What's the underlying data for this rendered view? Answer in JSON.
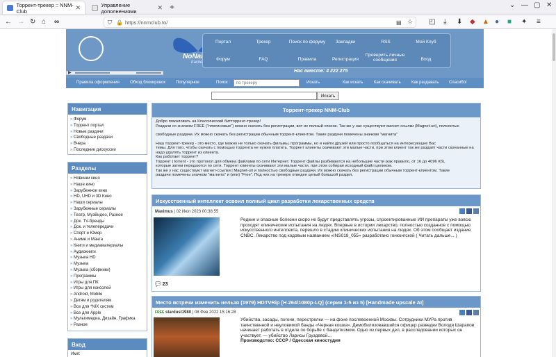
{
  "browser": {
    "tabs": [
      {
        "title": "Торрент-трекер :: NNM-Club",
        "active": true
      },
      {
        "title": "Управление дополнениями",
        "active": false
      }
    ],
    "url": "https://nnmclub.to/"
  },
  "site": {
    "logo_text": "NoNaMe Club",
    "logo_sub": "tracker & forum",
    "top_menu": [
      [
        "Портал",
        "Трекер",
        "Поиск по форуму",
        "Закладки",
        "RSS",
        "Мой Клуб"
      ],
      [
        "Форум",
        "FAQ",
        "Правила",
        "Регистрация",
        "Проверить личные сообщения",
        "Вход"
      ]
    ],
    "online": "Нас вместе: 4 222 275",
    "subnav": {
      "left": [
        "Правила оформления",
        "Обход блокировок",
        "Популярное"
      ],
      "search_label": "Поиск :",
      "search_placeholder": "по трекеру",
      "search_btn": "Искать",
      "right": [
        "Как искать",
        "Как скачивать",
        "Как раздавать",
        "Спасибо!"
      ]
    },
    "global_search_btn": "Искать"
  },
  "sidebar": {
    "nav_title": "Навигация",
    "nav_items": [
      "Форум",
      "Торрент портал",
      "Новые раздачи",
      "Свободные раздачи",
      "Вчера",
      "Последние дискуссии"
    ],
    "sections_title": "Разделы",
    "sections": [
      "Новинки кино",
      "Наше кино",
      "Зарубежное кино",
      "HD, UHD и 3D Кино",
      "Наши сериалы",
      "Зарубежные сериалы",
      "Театр, МузВидео, Разное",
      "Док. TV-бренды",
      "Док. и телепередачи",
      "Спорт и Юмор",
      "Аниме и Манга",
      "Книги и медиаматериалы",
      "Аудиокниги",
      "Музыка HD",
      "Музыка",
      "Музыка (сборники)",
      "Программы",
      "Игры для ПК",
      "Игры для консолей",
      "Android, Mobile",
      "Детям и родителям",
      "Все для *NIX систем",
      "Все для Apple",
      "Мультимедиа, Дизайн, Графика",
      "Разное"
    ],
    "login_title": "Вход",
    "login_label": "Имя:"
  },
  "welcome": {
    "title": "Торрент-трекер NNM-Club",
    "lines": [
      "Добро пожаловать на Классический битторрент-трекер!",
      "Раздачи со значком FREE (\"платиновые\") можно скачать без регистрации, вот их полный список. Так же у нас существуют магнет-ссылки (Magnet-uri), полностью",
      "свободные раздачи. Их можно скачать без регистрации обычным торрент-клиентом. Такие раздачи помечены значком \"магнита\"",
      "Наш торрент-трекер - это место, где можно не только скачать фильмы, программы, но и найти друзей или просто пообщаться на интересующие Вас",
      "темы. Для того, чтобы скачать с помощью торрента не нужно платить. Торрент клиенты скачивают эти малые части, при этом клиент так же раздаёт части скачанные на",
      "надо удалять торрент из клиента.",
      "Как работает торрент?",
      "Торрент | torrent - это протокол для обмена файлами по сети Интернет. Торрент файлы разбиваются на небольшие части (как правило, от 16 до 4096 Кб),",
      "которые затем передаются по сети. Торрент клиенты скачивают эти малые части, при этом собирая исходный файл целиком.",
      "Так же у нас существуют магнет-ссылки | Magnet-uri и полностью свободные раздачи. Их можно скачать без регистрации обычным торрент-клиентом. Такие",
      "раздачи помечены значком \"магнита\" и (или) \"Free\". Под них на трекере отведен целый большой раздел."
    ]
  },
  "news": [
    {
      "title": "Искусственный интеллект освоил полный цикл разработки лекарственных средств",
      "author": "Maximus",
      "date": "02 Июл 2023 00:38:55",
      "text": "Редкие и опасные болезни скоро не будут представлять угрозы, спроектированные ИИ препараты уже вовсю проходят клинические испытания на людях. Впервые в истории лекарство, полностью созданное с помощью искусственного интеллекта, перешло в стадию клинических испытания на людях. Об этом сообщает издание CNBC. Лекарство под кодовым названием «INS018_055» разработано гонконгской ( Читать дальше... )",
      "comments": "23"
    },
    {
      "title": "Место встречи изменить нельзя (1979) HDTVRip [H.264/1080p-LQ] (серии 1-5 из 5) [Handmade upscale AI]",
      "author": "stardust1980",
      "date": "08 Фев 2022 15:16:28",
      "text": "Убийства, засады, погони, перестрелки — на фоне послевоенной Москвы. Сотрудники МУРа против таинственной и неуловимой банды «Черная кошка». Демобилизовавшийся офицер разведки Володя Шарапов начинает работать в отделе по борьбе с бандитизмом. Одно из первых дел, в расследовании которых он участвует, — убийство Ларисы Груздевой...",
      "production": "Производство: СССР / Одесская киностудия"
    }
  ]
}
